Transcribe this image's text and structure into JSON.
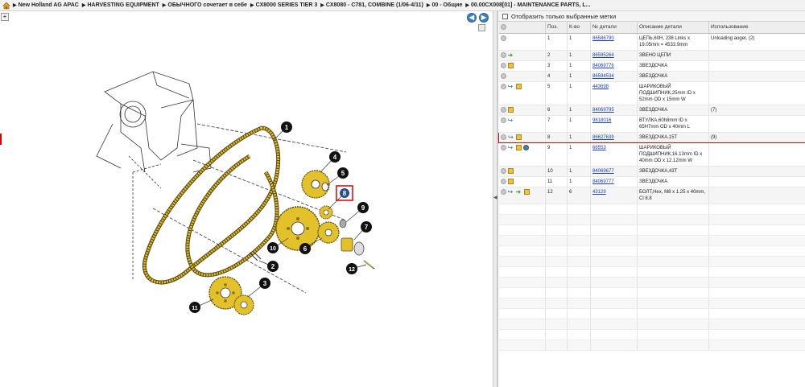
{
  "breadcrumb": [
    "New Holland AG APAC",
    "HARVESTING EQUIPMENT",
    "ОБЫЧНОГО сочетает в себе",
    "CX8000 SERIES TIER 3",
    "CX8080 - C781, COMBINE (1/06-4/11)",
    "00 - Общие",
    "00.00CX008[01] - MAINTENANCE PARTS, L..."
  ],
  "nav": {
    "back_label": "◀",
    "forward_label": "▶",
    "zoom_label": "+"
  },
  "filter": {
    "label": "Отобразить только выбранные метки"
  },
  "columns": {
    "pos": "Поз.",
    "qty": "К-во",
    "part": "№ детали",
    "desc": "Описание детали",
    "usage": "Использование"
  },
  "callouts": [
    "1",
    "2",
    "3",
    "4",
    "5",
    "6",
    "7",
    "8",
    "9",
    "10",
    "11",
    "12"
  ],
  "rows": [
    {
      "icons": [
        "add"
      ],
      "pos": "1",
      "qty": "1",
      "part": "86586790",
      "desc": "ЦЕПЬ,60H, 238 Links x 19.05mm = 4533.9mm",
      "usage": "Unloading auger, (2)"
    },
    {
      "icons": [
        "add",
        "green"
      ],
      "pos": "2",
      "qty": "1",
      "part": "86595264",
      "desc": "ЗВЕНО ЦЕПИ",
      "usage": ""
    },
    {
      "icons": [
        "add",
        "box"
      ],
      "pos": "3",
      "qty": "1",
      "part": "84069776",
      "desc": "ЗВЕЗДОЧКА",
      "usage": ""
    },
    {
      "icons": [
        "add"
      ],
      "pos": "4",
      "qty": "1",
      "part": "86594534",
      "desc": "ЗВЕЗДОЧКА",
      "usage": ""
    },
    {
      "icons": [
        "add",
        "blue",
        "box"
      ],
      "pos": "5",
      "qty": "1",
      "part": "443698",
      "desc": "ШАРИКОВЫЙ ПОДШИПНИК,25mm ID x 52mm OD x 15mm W",
      "usage": ""
    },
    {
      "icons": [
        "add",
        "box"
      ],
      "pos": "6",
      "qty": "1",
      "part": "84069795",
      "desc": "ЗВЕЗДОЧКА",
      "usage": "(7)"
    },
    {
      "icons": [
        "add",
        "blue"
      ],
      "pos": "7",
      "qty": "1",
      "part": "9818016",
      "desc": "ВТУЛКА,60h8mm ID x 65H7mm OD x 40mm L",
      "usage": ""
    },
    {
      "icons": [
        "add",
        "blue",
        "box"
      ],
      "pos": "8",
      "qty": "1",
      "part": "86627639",
      "desc": "ЗВЕЗДОЧКА,15T",
      "usage": "(9)",
      "selected": true
    },
    {
      "icons": [
        "add",
        "blue",
        "box",
        "gear"
      ],
      "pos": "9",
      "qty": "1",
      "part": "66553",
      "desc": "ШАРИКОВЫЙ ПОДШИПНИК,16.13mm ID x 40mm OD x 12.12mm W",
      "usage": ""
    },
    {
      "icons": [
        "add",
        "box"
      ],
      "pos": "10",
      "qty": "1",
      "part": "84069677",
      "desc": "ЗВЕЗДОЧКА,43T",
      "usage": ""
    },
    {
      "icons": [
        "add",
        "box"
      ],
      "pos": "11",
      "qty": "1",
      "part": "84069777",
      "desc": "ЗВЕЗДОЧКА",
      "usage": ""
    },
    {
      "icons": [
        "add",
        "blue",
        "green",
        "box"
      ],
      "pos": "12",
      "qty": "6",
      "part": "43129",
      "desc": "БОЛТ,Hex, M8 x 1.25 x 40mm, Cl 8.8",
      "usage": ""
    }
  ],
  "colors": {
    "accent": "#d00000",
    "link": "#1a3fc8",
    "selected_row": "#c9d6e8",
    "chain": "#d9b62a"
  }
}
